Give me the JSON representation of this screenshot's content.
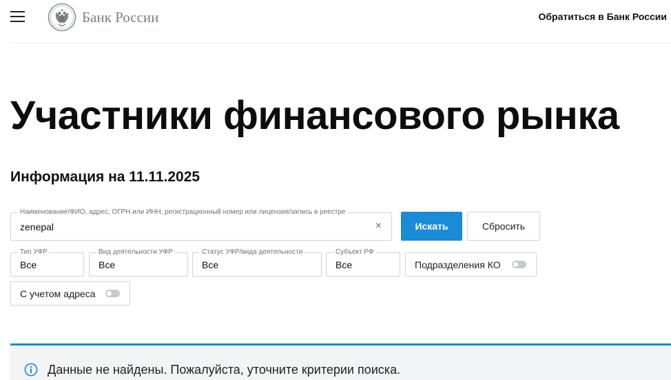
{
  "header": {
    "brand": "Банк России",
    "contact_link": "Обратиться в Банк России"
  },
  "page": {
    "title": "Участники финансового рынка",
    "info_date": "Информация на 11.11.2025"
  },
  "search": {
    "label": "Наименование/ФИО, адрес, ОГРН или ИНН, регистрационный номер или лицензия/запись в реестре",
    "value": "zenepal",
    "search_button": "Искать",
    "reset_button": "Сбросить"
  },
  "filters": [
    {
      "label": "Тип УФР",
      "value": "Все"
    },
    {
      "label": "Вид деятельности УФР",
      "value": "Все"
    },
    {
      "label": "Статус УФР/вида деятельности",
      "value": "Все"
    },
    {
      "label": "Субъект РФ",
      "value": "Все"
    }
  ],
  "toggles": {
    "ko_divisions": {
      "label": "Подразделения КО",
      "on": false
    },
    "with_address": {
      "label": "С учетом адреса",
      "on": false
    }
  },
  "notice": {
    "text": "Данные не найдены. Пожалуйста, уточните критерии поиска."
  },
  "colors": {
    "accent": "#1a8bd6",
    "notice_bg": "#f3f4f5",
    "border": "#cfd3d7"
  },
  "icons": {
    "menu": "hamburger-menu-icon",
    "logo": "double-headed-eagle-emblem",
    "clear": "close-icon",
    "notice": "info-circle-icon"
  }
}
